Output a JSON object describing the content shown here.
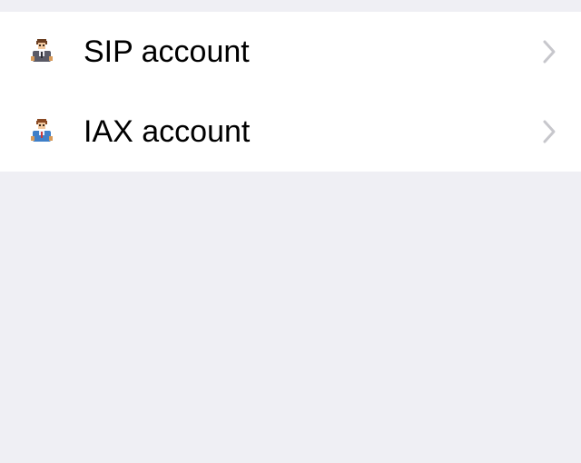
{
  "accounts_list": {
    "items": [
      {
        "label": "SIP account",
        "icon": "user-person-icon"
      },
      {
        "label": "IAX account",
        "icon": "user-person-icon"
      }
    ]
  },
  "colors": {
    "background": "#efeff4",
    "row_background": "#ffffff",
    "text": "#000000",
    "chevron": "#c7c7cc",
    "sip_icon_suit": "#5a5a66",
    "iax_icon_suit": "#3f7fc8"
  }
}
